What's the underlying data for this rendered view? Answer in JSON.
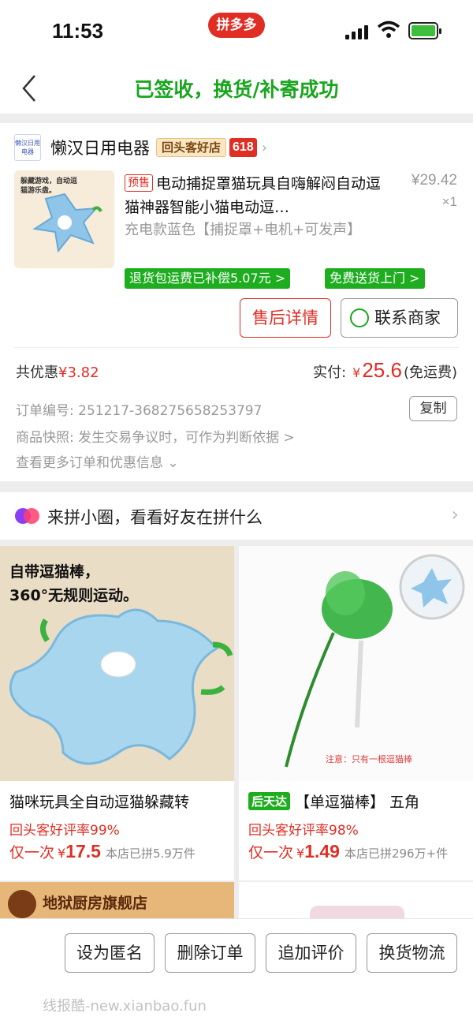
{
  "status_bar": {
    "time": "11:53",
    "app_badge": "拼多多"
  },
  "header": {
    "title": "已签收，换货/补寄成功"
  },
  "order": {
    "shop_name": "懒汉日用电器",
    "shop_logo_text": "懒汉日用电器",
    "repeat_badge": "回头客好店",
    "count_badge": "618",
    "thumb_text": "躲藏游戏，自动逗猫游乐盘。",
    "presale_tag": "预售",
    "product_title": "电动捕捉罩猫玩具自嗨解闷自动逗猫神器智能小猫电动逗…",
    "unit_price": "¥29.42",
    "quantity": "×1",
    "spec": "充电款蓝色【捕捉罩+电机+可发声】",
    "tag_refund": "退货包运费已补偿5.07元 >",
    "tag_delivery": "免费送货上门 >",
    "btn_after_sale": "售后详情",
    "btn_contact": "联系商家",
    "discount_label": "共优惠",
    "discount_value": "¥3.82",
    "paid_label": "实付:",
    "paid_yen": "¥",
    "paid_amount": "25.6",
    "paid_note": "(免运费)",
    "order_no_line": "订单编号:   251217-368275658253797",
    "copy_label": "复制",
    "snapshot_line": "商品快照:   发生交易争议时，可作为判断依据 >",
    "more_line": "查看更多订单和优惠信息 ⌄"
  },
  "circle": {
    "text": "来拼小圈，看看好友在拼什么"
  },
  "tiles": [
    {
      "image_text_1": "自带逗猫棒，",
      "image_text_2": "360°无规则运动。",
      "fast_badge": "",
      "name": "猫咪玩具全自动逗猫躲藏转",
      "rate": "回头客好评率99%",
      "price_prefix": "仅一次",
      "price_yen": "¥",
      "price": "17.5",
      "sold": "本店已拼5.9万件"
    },
    {
      "image_text_1": "注意：只有一根逗猫棒",
      "image_text_2": "",
      "fast_badge": "后天达",
      "name": "【单逗猫棒】 五角",
      "rate": "回头客好评率98%",
      "price_prefix": "仅一次",
      "price_yen": "¥",
      "price": "1.49",
      "sold": "本店已拼296万+件"
    }
  ],
  "next_tile": {
    "shop": "地狱厨房旗舰店"
  },
  "actions": {
    "anonymous": "设为匿名",
    "delete": "删除订单",
    "review": "追加评价",
    "logistics": "换货物流"
  },
  "watermark": "线报酷-new.xianbao.fun",
  "colors": {
    "green": "#1aa51f",
    "red": "#e02e24",
    "brand_red": "#e02e24"
  }
}
